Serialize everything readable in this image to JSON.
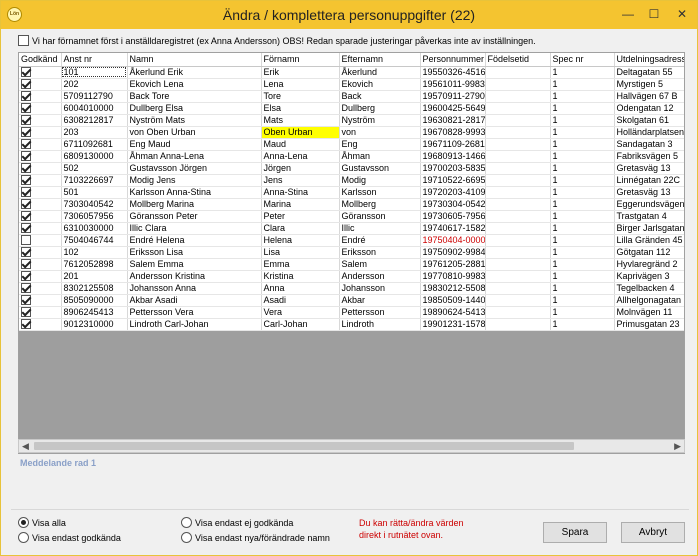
{
  "window": {
    "title": "Ändra / komplettera personuppgifter (22)",
    "app_icon_text": "Lön",
    "minimize_glyph": "—",
    "maximize_glyph": "☐",
    "close_glyph": "✕"
  },
  "option": {
    "label": "Vi har förnamnet först i anställdaregistret (ex Anna Andersson) OBS! Redan sparade justeringar påverkas inte av inställningen.",
    "checked": false
  },
  "grid": {
    "columns": [
      "Godkänd",
      "Anst nr",
      "Namn",
      "Förnamn",
      "Efternamn",
      "Personnummer",
      "Födelsetid",
      "Spec nr",
      "Utdelningsadress"
    ],
    "rows": [
      {
        "checked": true,
        "anst": "101",
        "namn": "Åkerlund Erik",
        "fornamn": "Erik",
        "efternamn": "Åkerlund",
        "pnr": "19550326-4516",
        "fodelsetid": "",
        "spec": "1",
        "adress": "Deltagatan 55"
      },
      {
        "checked": true,
        "anst": "202",
        "namn": "Ekovich Lena",
        "fornamn": "Lena",
        "efternamn": "Ekovich",
        "pnr": "19561011-9983",
        "fodelsetid": "",
        "spec": "1",
        "adress": "Myrstigen 5"
      },
      {
        "checked": true,
        "anst": "5709112790",
        "namn": "Back Tore",
        "fornamn": "Tore",
        "efternamn": "Back",
        "pnr": "19570911-2790",
        "fodelsetid": "",
        "spec": "1",
        "adress": "Hallvägen 67 B"
      },
      {
        "checked": true,
        "anst": "6004010000",
        "namn": "Dullberg Elsa",
        "fornamn": "Elsa",
        "efternamn": "Dullberg",
        "pnr": "19600425-5649",
        "fodelsetid": "",
        "spec": "1",
        "adress": "Odengatan 12"
      },
      {
        "checked": true,
        "anst": "6308212817",
        "namn": "Nyström Mats",
        "fornamn": "Mats",
        "efternamn": "Nyström",
        "pnr": "19630821-2817",
        "fodelsetid": "",
        "spec": "1",
        "adress": "Skolgatan 61"
      },
      {
        "checked": true,
        "anst": "203",
        "namn": "von Oben Urban",
        "fornamn": "Oben Urban",
        "efternamn": "von",
        "pnr": "19670828-9993",
        "fodelsetid": "",
        "spec": "1",
        "adress": "Holländarplatsen",
        "highlight": true
      },
      {
        "checked": true,
        "anst": "6711092681",
        "namn": "Eng Maud",
        "fornamn": "Maud",
        "efternamn": "Eng",
        "pnr": "19671109-2681",
        "fodelsetid": "",
        "spec": "1",
        "adress": "Sandagatan 3"
      },
      {
        "checked": true,
        "anst": "6809130000",
        "namn": "Åhman Anna-Lena",
        "fornamn": "Anna-Lena",
        "efternamn": "Åhman",
        "pnr": "19680913-1466",
        "fodelsetid": "",
        "spec": "1",
        "adress": "Fabriksvägen 5"
      },
      {
        "checked": true,
        "anst": "502",
        "namn": "Gustavsson Jörgen",
        "fornamn": "Jörgen",
        "efternamn": "Gustavsson",
        "pnr": "19700203-5835",
        "fodelsetid": "",
        "spec": "1",
        "adress": "Gretasväg 13"
      },
      {
        "checked": true,
        "anst": "7103226697",
        "namn": "Modig Jens",
        "fornamn": "Jens",
        "efternamn": "Modig",
        "pnr": "19710522-6695",
        "fodelsetid": "",
        "spec": "1",
        "adress": "Linnégatan 22C"
      },
      {
        "checked": true,
        "anst": "501",
        "namn": "Karlsson Anna-Stina",
        "fornamn": "Anna-Stina",
        "efternamn": "Karlsson",
        "pnr": "19720203-4109",
        "fodelsetid": "",
        "spec": "1",
        "adress": "Gretasväg 13"
      },
      {
        "checked": true,
        "anst": "7303040542",
        "namn": "Mollberg Marina",
        "fornamn": "Marina",
        "efternamn": "Mollberg",
        "pnr": "19730304-0542",
        "fodelsetid": "",
        "spec": "1",
        "adress": "Eggerundsvägen"
      },
      {
        "checked": true,
        "anst": "7306057956",
        "namn": "Göransson Peter",
        "fornamn": "Peter",
        "efternamn": "Göransson",
        "pnr": "19730605-7956",
        "fodelsetid": "",
        "spec": "1",
        "adress": "Trastgatan 4"
      },
      {
        "checked": true,
        "anst": "6310030000",
        "namn": "Illic Clara",
        "fornamn": "Clara",
        "efternamn": "Illic",
        "pnr": "19740617-1582",
        "fodelsetid": "",
        "spec": "1",
        "adress": "Birger Jarlsgatan"
      },
      {
        "checked": false,
        "anst": "7504046744",
        "namn": "Endré Helena",
        "fornamn": "Helena",
        "efternamn": "Endré",
        "pnr": "19750404-0000",
        "fodelsetid": "",
        "spec": "1",
        "adress": "Lilla Gränden 45",
        "warn": true
      },
      {
        "checked": true,
        "anst": "102",
        "namn": "Eriksson Lisa",
        "fornamn": "Lisa",
        "efternamn": "Eriksson",
        "pnr": "19750902-9984",
        "fodelsetid": "",
        "spec": "1",
        "adress": "Götgatan 112"
      },
      {
        "checked": true,
        "anst": "7612052898",
        "namn": "Salem Emma",
        "fornamn": "Emma",
        "efternamn": "Salem",
        "pnr": "19761205-2881",
        "fodelsetid": "",
        "spec": "1",
        "adress": "Hyvlaregränd 2"
      },
      {
        "checked": true,
        "anst": "201",
        "namn": "Andersson Kristina",
        "fornamn": "Kristina",
        "efternamn": "Andersson",
        "pnr": "19770810-9983",
        "fodelsetid": "",
        "spec": "1",
        "adress": "Kaprivägen 3"
      },
      {
        "checked": true,
        "anst": "8302125508",
        "namn": "Johansson Anna",
        "fornamn": "Anna",
        "efternamn": "Johansson",
        "pnr": "19830212-5508",
        "fodelsetid": "",
        "spec": "1",
        "adress": "Tegelbacken 4"
      },
      {
        "checked": true,
        "anst": "8505090000",
        "namn": "Akbar Asadi",
        "fornamn": "Asadi",
        "efternamn": "Akbar",
        "pnr": "19850509-1440",
        "fodelsetid": "",
        "spec": "1",
        "adress": "Allhelgonagatan"
      },
      {
        "checked": true,
        "anst": "8906245413",
        "namn": "Pettersson Vera",
        "fornamn": "Vera",
        "efternamn": "Pettersson",
        "pnr": "19890624-5413",
        "fodelsetid": "",
        "spec": "1",
        "adress": "Molnvägen 11"
      },
      {
        "checked": true,
        "anst": "9012310000",
        "namn": "Lindroth Carl-Johan",
        "fornamn": "Carl-Johan",
        "efternamn": "Lindroth",
        "pnr": "19901231-1578",
        "fodelsetid": "",
        "spec": "1",
        "adress": "Primusgatan 23"
      }
    ]
  },
  "scrollbar": {
    "left_glyph": "◀",
    "right_glyph": "▶"
  },
  "message": {
    "label": "Meddelande rad 1"
  },
  "filters": {
    "show_all": "Visa alla",
    "show_approved": "Visa endast  godkända",
    "show_not_approved": "Visa endast ej godkända",
    "show_new_changed": "Visa endast nya/förändrade namn"
  },
  "hint": "Du kan rätta/ändra värden direkt i rutnätet ovan.",
  "buttons": {
    "save": "Spara",
    "cancel": "Avbryt"
  },
  "colors": {
    "titlebar": "#f4c430",
    "highlight": "#ffff00",
    "warning": "#cc0000",
    "message": "#8aa0c8"
  }
}
